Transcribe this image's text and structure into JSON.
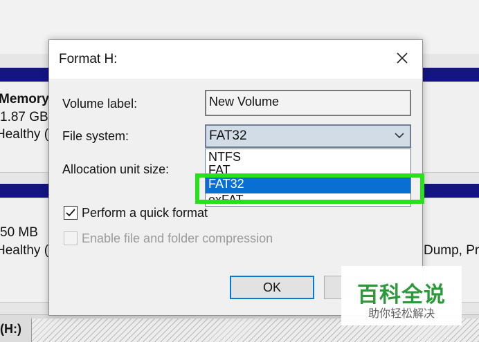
{
  "background": {
    "disk1": {
      "name": "Memory",
      "size": "1.87 GB",
      "status": "Healthy ("
    },
    "disk2": {
      "size": "50 MB",
      "status": "Healthy (",
      "right_status": "Dump, Pr"
    },
    "bottom_volume": "(H:)",
    "bar_color": "#141483"
  },
  "dialog": {
    "title": "Format H:",
    "volume_label": {
      "label": "Volume label:",
      "value": "New Volume"
    },
    "file_system": {
      "label": "File system:",
      "selected": "FAT32",
      "options": [
        "NTFS",
        "FAT",
        "FAT32",
        "exFAT"
      ],
      "highlighted_option": "FAT32",
      "highlight_color": "#0a6fd3"
    },
    "allocation": {
      "label": "Allocation unit size:"
    },
    "quick_format": {
      "label": "Perform a quick format",
      "checked": true
    },
    "compression": {
      "label": "Enable file and folder compression",
      "checked": false,
      "enabled": false
    },
    "buttons": {
      "ok": "OK"
    }
  },
  "annotation": {
    "color": "#27e11c"
  },
  "watermark": {
    "main": "百科全说",
    "sub": "助你轻松解决",
    "color": "#2b9a3a"
  }
}
